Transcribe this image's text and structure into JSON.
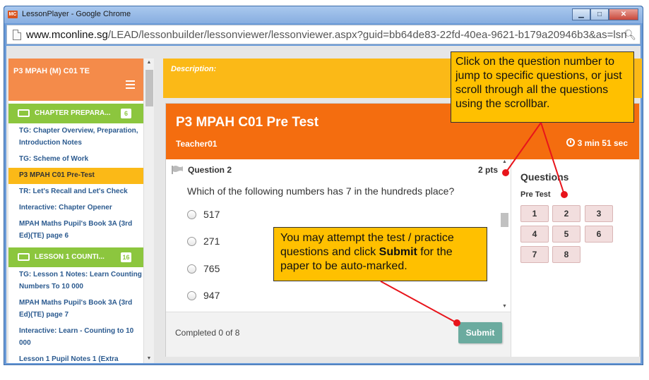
{
  "window": {
    "app_icon": "MC",
    "title": "LessonPlayer - Google Chrome",
    "minimize": "▁",
    "maximize": "□",
    "close": "✕"
  },
  "address": {
    "url_host": "www.mconline.sg",
    "url_path": "/LEAD/lessonbuilder/lessonviewer/lessonviewer.aspx?guid=bb64de83-22fd-40ea-9621-b179a20946b3&as=lsn_pre",
    "search_icon": "magnifier-icon"
  },
  "sidebar": {
    "header_title": "P3 MPAH (M) C01 TE",
    "chapters": [
      {
        "label": "CHAPTER PREPARA...",
        "badge": "6",
        "items": [
          {
            "label": "TG: Chapter Overview, Preparation, Introduction Notes",
            "active": false
          },
          {
            "label": "TG: Scheme of Work",
            "active": false
          },
          {
            "label": "P3 MPAH C01 Pre-Test",
            "active": true
          },
          {
            "label": "TR: Let's Recall and Let's Check",
            "active": false
          },
          {
            "label": "Interactive: Chapter Opener",
            "active": false
          },
          {
            "label": "MPAH Maths Pupil's Book 3A (3rd Ed)(TE) page 6",
            "active": false
          }
        ]
      },
      {
        "label": "LESSON 1 COUNTI...",
        "badge": "16",
        "items": [
          {
            "label": "TG: Lesson 1 Notes: Learn Counting Numbers To 10 000",
            "active": false
          },
          {
            "label": "MPAH Maths Pupil's Book 3A (3rd Ed)(TE) page 7",
            "active": false
          },
          {
            "label": "Interactive: Learn - Counting to 10 000",
            "active": false
          },
          {
            "label": "Lesson 1 Pupil Notes 1 (Extra",
            "active": false
          }
        ]
      }
    ]
  },
  "main": {
    "description_label": "Description:",
    "test_title": "P3 MPAH C01 Pre Test",
    "teacher": "Teacher01",
    "timer": "3 min 51 sec",
    "question": {
      "number_label": "Question 2",
      "points": "2 pts",
      "text": "Which of the following numbers has 7 in the hundreds place?",
      "options": [
        "517",
        "271",
        "765",
        "947"
      ]
    },
    "completed": "Completed 0 of 8",
    "submit": "Submit",
    "nav": {
      "title": "Questions",
      "subtitle": "Pre Test",
      "buttons": [
        "1",
        "2",
        "3",
        "4",
        "5",
        "6",
        "7",
        "8"
      ]
    }
  },
  "callouts": {
    "top": "Click on the question number to jump to specific questions, or just scroll through all the questions using the scrollbar.",
    "mid_before": "You may attempt the test / practice questions and click ",
    "mid_bold": "Submit",
    "mid_after": " for the paper to be auto-marked."
  },
  "colors": {
    "sidebar_header": "#f48b4a",
    "chapter_green": "#8cc63e",
    "active_item": "#fbb917",
    "test_header": "#f46d0f",
    "submit": "#6bab9f",
    "callout": "#ffc000",
    "annotation_red": "#e8141b"
  }
}
